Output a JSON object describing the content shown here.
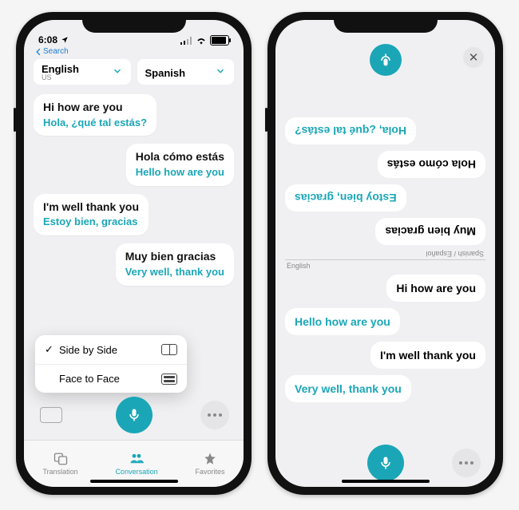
{
  "colors": {
    "accent": "#1aa6b7"
  },
  "phone1": {
    "status": {
      "time": "6:08",
      "back_label": "Search"
    },
    "lang_from": {
      "name": "English",
      "region": "US"
    },
    "lang_to": {
      "name": "Spanish",
      "region": ""
    },
    "conversation": [
      {
        "side": "left",
        "original": "Hi how are you",
        "translated": "Hola, ¿qué tal estás?"
      },
      {
        "side": "right",
        "original": "Hola cómo estás",
        "translated": "Hello how are you"
      },
      {
        "side": "left",
        "original": "I'm well thank you",
        "translated": "Estoy bien, gracias"
      },
      {
        "side": "right",
        "original": "Muy bien gracias",
        "translated": "Very well, thank you"
      }
    ],
    "menu": {
      "items": [
        {
          "label": "Side by Side",
          "checked": true,
          "icon": "split"
        },
        {
          "label": "Face to Face",
          "checked": false,
          "icon": "stack"
        }
      ]
    },
    "tabs": {
      "translation": "Translation",
      "conversation": "Conversation",
      "favorites": "Favorites",
      "active": "conversation"
    }
  },
  "phone2": {
    "labels": {
      "upper": "Spanish / Español",
      "lower": "English"
    },
    "upper_bubbles": [
      {
        "side": "left",
        "teal": false,
        "text": "Muy bien gracias"
      },
      {
        "side": "right",
        "teal": true,
        "text": "Estoy bien, gracias"
      },
      {
        "side": "left",
        "teal": false,
        "text": "Hola cómo estás"
      },
      {
        "side": "right",
        "teal": true,
        "text": "Hola, ¿qué tal estás?"
      }
    ],
    "lower_bubbles": [
      {
        "side": "right",
        "teal": false,
        "text": "Hi how are you"
      },
      {
        "side": "left",
        "teal": true,
        "text": "Hello how are you"
      },
      {
        "side": "right",
        "teal": false,
        "text": "I'm well thank you"
      },
      {
        "side": "left",
        "teal": true,
        "text": "Very well, thank you"
      }
    ]
  }
}
